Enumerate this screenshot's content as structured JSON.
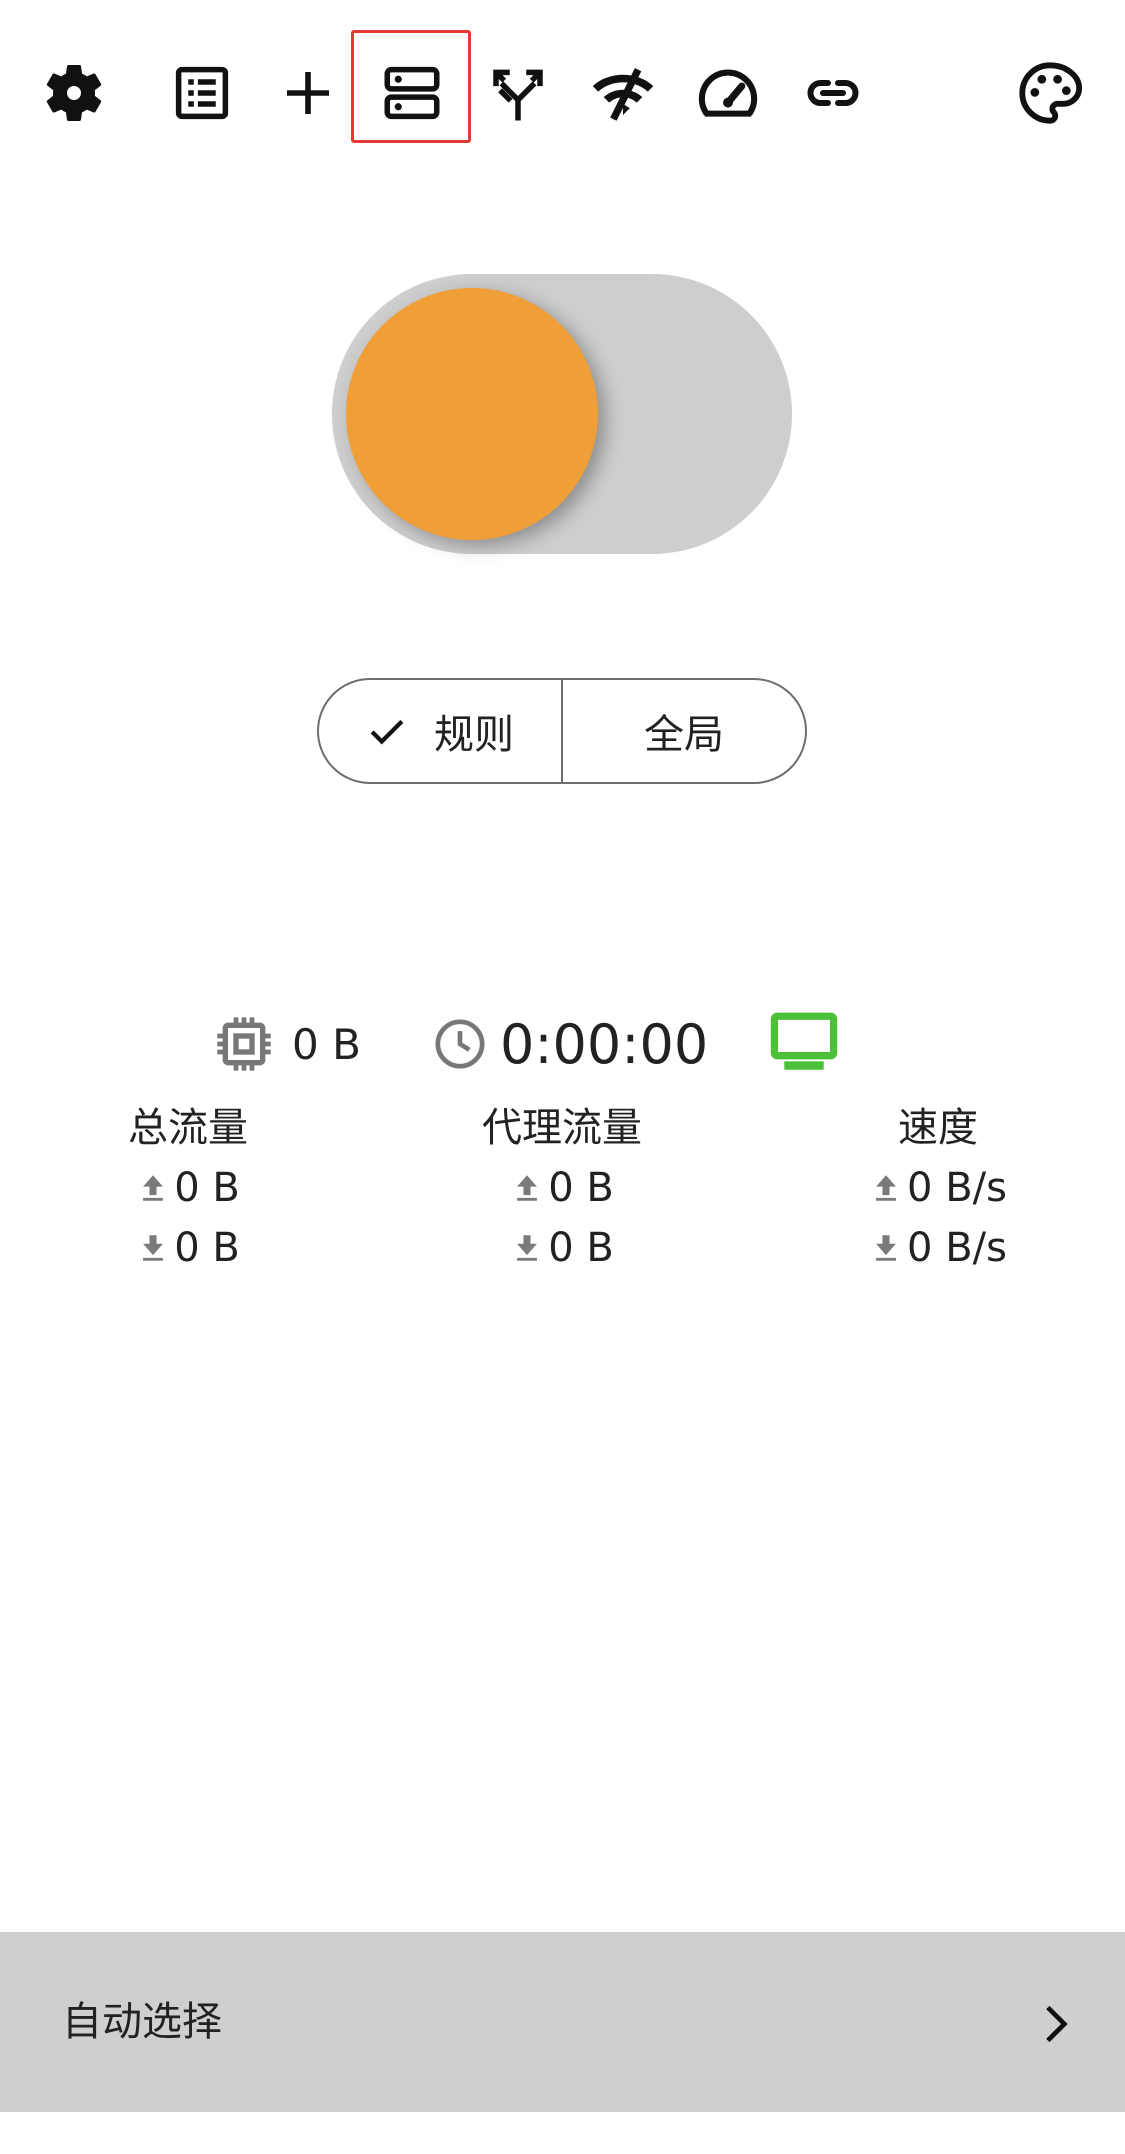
{
  "toolbar": {
    "icons": [
      "gear-icon",
      "list-icon",
      "plus-icon",
      "server-icon",
      "split-arrows-icon",
      "wifi-off-icon",
      "speedometer-icon",
      "link-icon",
      "palette-icon"
    ],
    "highlighted": "server-icon",
    "highlight_color": "#e53935"
  },
  "proxy_switch": {
    "state": "off",
    "knob_color": "#f09e38",
    "track_color": "#cecece"
  },
  "mode": {
    "options": [
      "规则",
      "全局"
    ],
    "selected": "规则"
  },
  "status": {
    "memory": "0 B",
    "uptime": "0:00:00",
    "connection_icon": "monitor-icon",
    "connection_color": "#4cc038"
  },
  "stats": {
    "total": {
      "title": "总流量",
      "up": "0 B",
      "down": "0 B"
    },
    "proxy": {
      "title": "代理流量",
      "up": "0 B",
      "down": "0 B"
    },
    "speed": {
      "title": "速度",
      "up": "0 B/s",
      "down": "0 B/s"
    }
  },
  "bottom": {
    "label": "自动选择"
  }
}
